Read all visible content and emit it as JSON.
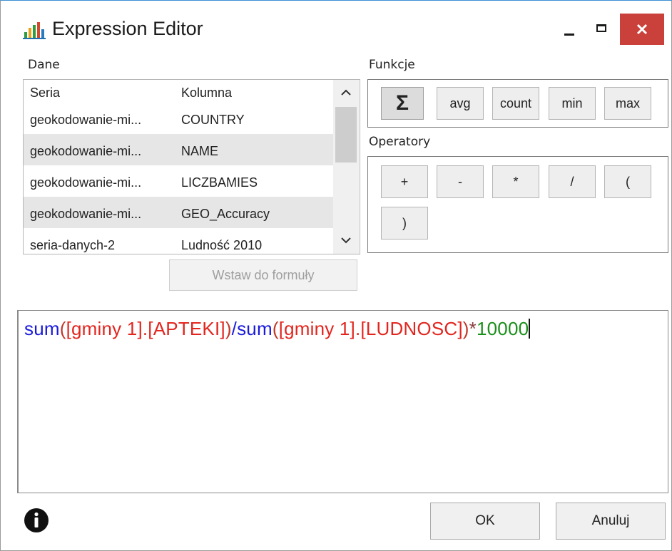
{
  "window": {
    "title": "Expression Editor",
    "icon": "bar-chart-icon",
    "controls": [
      "minimize-icon",
      "maximize-icon",
      "close-icon"
    ],
    "close_color": "#c9413a"
  },
  "data_panel": {
    "label": "Dane",
    "columns": [
      "Seria",
      "Kolumna"
    ],
    "rows": [
      {
        "seria": "geokodowanie-mi...",
        "kolumna": "COUNTRY"
      },
      {
        "seria": "geokodowanie-mi...",
        "kolumna": "NAME"
      },
      {
        "seria": "geokodowanie-mi...",
        "kolumna": "LICZBAMIES"
      },
      {
        "seria": "geokodowanie-mi...",
        "kolumna": "GEO_Accuracy"
      },
      {
        "seria": "seria-danych-2",
        "kolumna": "Ludność 2010"
      }
    ],
    "insert_button": "Wstaw do formuły"
  },
  "functions": {
    "label": "Funkcje",
    "items": [
      "Σ",
      "avg",
      "count",
      "min",
      "max"
    ]
  },
  "operators": {
    "label": "Operatory",
    "items": [
      "+",
      "-",
      "*",
      "/",
      "(",
      ")"
    ]
  },
  "editor": {
    "tokens": [
      {
        "text": "sum",
        "kind": "fn"
      },
      {
        "text": "(",
        "kind": "br"
      },
      {
        "text": "[gminy 1].[APTEKI]",
        "kind": "ref"
      },
      {
        "text": ")",
        "kind": "br"
      },
      {
        "text": "/",
        "kind": "fn"
      },
      {
        "text": "sum",
        "kind": "fn"
      },
      {
        "text": "(",
        "kind": "br"
      },
      {
        "text": "[gminy 1].[LUDNOSC]",
        "kind": "ref"
      },
      {
        "text": ")",
        "kind": "br"
      },
      {
        "text": "*",
        "kind": "op"
      },
      {
        "text": "10000",
        "kind": "num"
      }
    ]
  },
  "footer": {
    "info_icon": "info-icon",
    "ok": "OK",
    "cancel": "Anuluj"
  }
}
